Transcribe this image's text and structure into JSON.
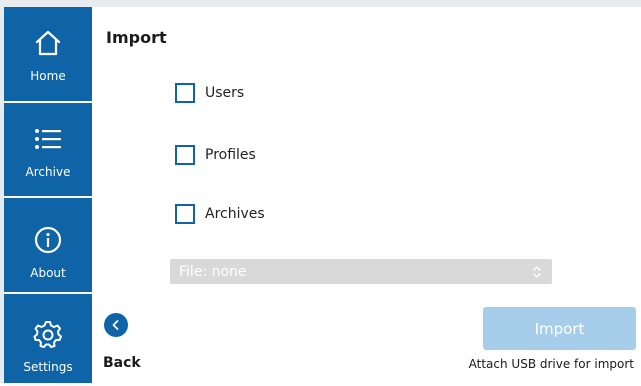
{
  "sidebar": {
    "items": [
      {
        "label": "Home",
        "icon": "home-icon"
      },
      {
        "label": "Archive",
        "icon": "list-icon"
      },
      {
        "label": "About",
        "icon": "info-icon"
      },
      {
        "label": "Settings",
        "icon": "gear-icon"
      }
    ]
  },
  "main": {
    "title": "Import",
    "options": [
      {
        "label": "Users",
        "checked": false
      },
      {
        "label": "Profiles",
        "checked": false
      },
      {
        "label": "Archives",
        "checked": false
      }
    ],
    "file_select": {
      "value": "File: none",
      "icon": "chevron-updown-icon"
    },
    "back_label": "Back",
    "import_label": "Import",
    "hint": "Attach USB drive for import"
  },
  "colors": {
    "primary": "#0e64a6",
    "disabled_button": "#a6cde9",
    "disabled_select": "#d9d9d9"
  }
}
